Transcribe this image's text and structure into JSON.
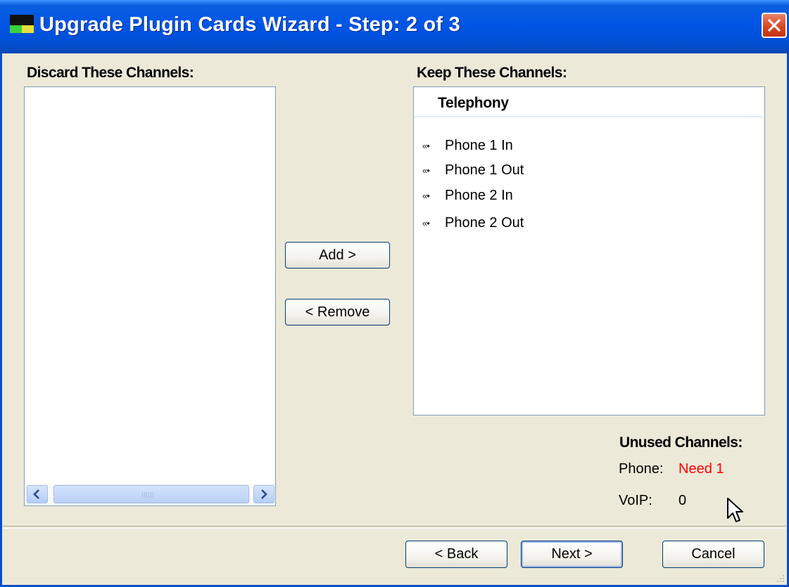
{
  "window": {
    "title": "Upgrade Plugin Cards Wizard - Step: 2 of 3"
  },
  "discard": {
    "label": "Discard These Channels:",
    "items": []
  },
  "keep": {
    "label": "Keep These Channels:",
    "column_header": "Telephony",
    "items": [
      {
        "icon": "channel-icon",
        "label": "Phone 1 In"
      },
      {
        "icon": "channel-icon",
        "label": "Phone 1 Out"
      },
      {
        "icon": "channel-icon",
        "label": "Phone 2 In"
      },
      {
        "icon": "channel-icon",
        "label": "Phone 2 Out"
      }
    ]
  },
  "transfer": {
    "add_label": "Add >",
    "remove_label": "< Remove"
  },
  "unused": {
    "title": "Unused Channels:",
    "phone_label": "Phone:",
    "phone_value": "Need 1",
    "phone_value_color": "#ff0000",
    "voip_label": "VoIP:",
    "voip_value": "0"
  },
  "footer": {
    "back_label": "< Back",
    "next_label": "Next >",
    "cancel_label": "Cancel"
  }
}
